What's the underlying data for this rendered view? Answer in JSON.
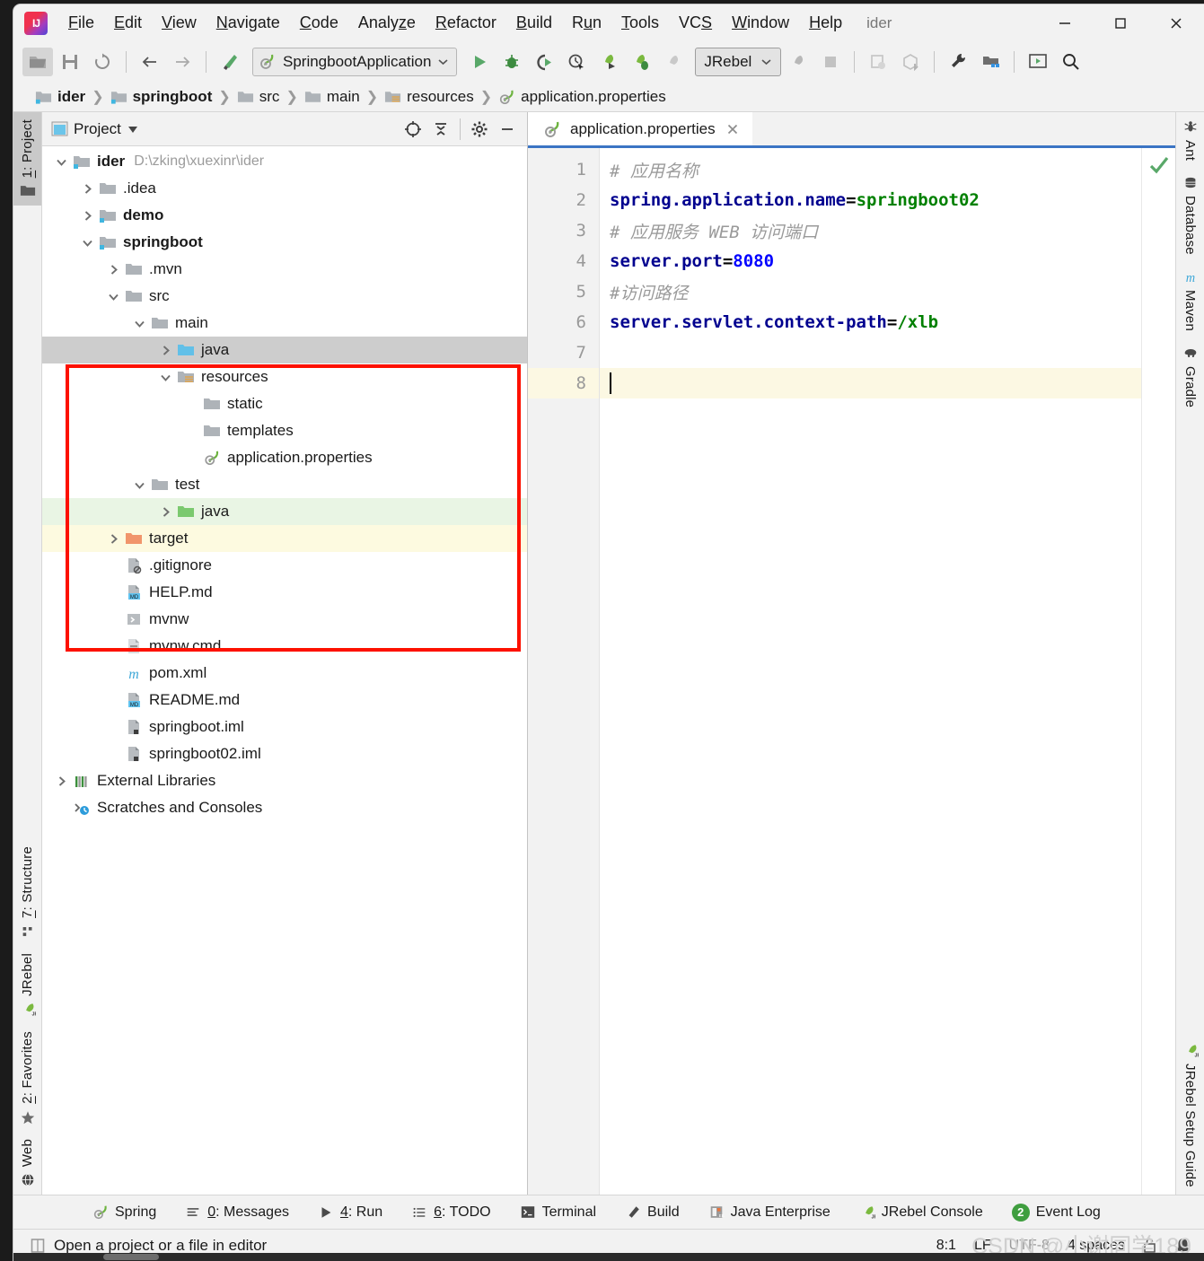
{
  "window": {
    "project_title": "ider",
    "minimize_tooltip": "Minimize",
    "maximize_tooltip": "Maximize",
    "close_tooltip": "Close"
  },
  "menubar": {
    "items": [
      {
        "label": "File",
        "mnemonic": "F"
      },
      {
        "label": "Edit",
        "mnemonic": "E"
      },
      {
        "label": "View",
        "mnemonic": "V"
      },
      {
        "label": "Navigate",
        "mnemonic": "N"
      },
      {
        "label": "Code",
        "mnemonic": "C"
      },
      {
        "label": "Analyze",
        "mnemonic": "z"
      },
      {
        "label": "Refactor",
        "mnemonic": "R"
      },
      {
        "label": "Build",
        "mnemonic": "B"
      },
      {
        "label": "Run",
        "mnemonic": "u"
      },
      {
        "label": "Tools",
        "mnemonic": "T"
      },
      {
        "label": "VCS",
        "mnemonic": "S"
      },
      {
        "label": "Window",
        "mnemonic": "W"
      },
      {
        "label": "Help",
        "mnemonic": "H"
      }
    ]
  },
  "toolbar": {
    "run_config": "SpringbootApplication",
    "jrebel_select": "JRebel",
    "icons": [
      "open-project-icon",
      "save-all-icon",
      "sync-icon",
      "back-icon",
      "forward-icon",
      "build-hammer-icon",
      "run-icon",
      "debug-icon",
      "run-coverage-icon",
      "profile-icon",
      "jrebel-run-icon",
      "jrebel-debug-icon",
      "jrebel-disabled-icon",
      "jrebel-stop-icon",
      "stop-icon",
      "update-project-icon",
      "commit-icon",
      "settings-wrench-icon",
      "project-structure-icon",
      "presentation-icon",
      "search-everywhere-icon"
    ]
  },
  "breadcrumb": {
    "items": [
      {
        "label": "ider",
        "icon": "module-folder-icon",
        "bold": true
      },
      {
        "label": "springboot",
        "icon": "module-folder-icon",
        "bold": true
      },
      {
        "label": "src",
        "icon": "folder-icon",
        "bold": false
      },
      {
        "label": "main",
        "icon": "folder-icon",
        "bold": false
      },
      {
        "label": "resources",
        "icon": "resources-folder-icon",
        "bold": false
      },
      {
        "label": "application.properties",
        "icon": "spring-leaf-icon",
        "bold": false
      }
    ]
  },
  "left_stripe": {
    "items": [
      {
        "label": "1: Project",
        "mnemonic": "1",
        "icon": "project-folder-icon",
        "selected": true
      },
      {
        "label": "7: Structure",
        "mnemonic": "7",
        "icon": "structure-icon",
        "selected": false
      },
      {
        "label": "JRebel",
        "mnemonic": "",
        "icon": "jrebel-rocket-icon",
        "selected": false
      },
      {
        "label": "2: Favorites",
        "mnemonic": "2",
        "icon": "star-icon",
        "selected": false
      },
      {
        "label": "Web",
        "mnemonic": "",
        "icon": "globe-icon",
        "selected": false
      }
    ]
  },
  "right_stripe": {
    "items": [
      {
        "label": "Ant",
        "icon": "ant-bug-icon"
      },
      {
        "label": "Database",
        "icon": "database-icon"
      },
      {
        "label": "Maven",
        "icon": "maven-m-icon"
      },
      {
        "label": "Gradle",
        "icon": "gradle-elephant-icon"
      },
      {
        "label": "JRebel Setup Guide",
        "icon": "jrebel-rocket-icon"
      }
    ]
  },
  "project_panel": {
    "title": "Project",
    "header_icons": [
      "select-opened-file-icon",
      "collapse-all-icon",
      "settings-gear-icon",
      "hide-icon"
    ],
    "tree": [
      {
        "label": "ider",
        "path": "D:\\zking\\xuexinr\\ider",
        "indent": 0,
        "arrow": "down",
        "icon": "module-folder-icon",
        "bold": true,
        "bg": "none"
      },
      {
        "label": ".idea",
        "path": "",
        "indent": 1,
        "arrow": "right",
        "icon": "folder-icon",
        "bold": false,
        "bg": "none"
      },
      {
        "label": "demo",
        "path": "",
        "indent": 1,
        "arrow": "right",
        "icon": "module-folder-icon",
        "bold": true,
        "bg": "none"
      },
      {
        "label": "springboot",
        "path": "",
        "indent": 1,
        "arrow": "down",
        "icon": "module-folder-icon",
        "bold": true,
        "bg": "none"
      },
      {
        "label": ".mvn",
        "path": "",
        "indent": 2,
        "arrow": "right",
        "icon": "folder-icon",
        "bold": false,
        "bg": "none"
      },
      {
        "label": "src",
        "path": "",
        "indent": 2,
        "arrow": "down",
        "icon": "folder-icon",
        "bold": false,
        "bg": "none"
      },
      {
        "label": "main",
        "path": "",
        "indent": 3,
        "arrow": "down",
        "icon": "folder-icon",
        "bold": false,
        "bg": "none"
      },
      {
        "label": "java",
        "path": "",
        "indent": 4,
        "arrow": "right",
        "icon": "source-folder-icon",
        "bold": false,
        "bg": "gray"
      },
      {
        "label": "resources",
        "path": "",
        "indent": 4,
        "arrow": "down",
        "icon": "resources-folder-icon",
        "bold": false,
        "bg": "none"
      },
      {
        "label": "static",
        "path": "",
        "indent": 5,
        "arrow": "none",
        "icon": "folder-icon",
        "bold": false,
        "bg": "none"
      },
      {
        "label": "templates",
        "path": "",
        "indent": 5,
        "arrow": "none",
        "icon": "folder-icon",
        "bold": false,
        "bg": "none"
      },
      {
        "label": "application.properties",
        "path": "",
        "indent": 5,
        "arrow": "none",
        "icon": "spring-leaf-icon",
        "bold": false,
        "bg": "none"
      },
      {
        "label": "test",
        "path": "",
        "indent": 3,
        "arrow": "down",
        "icon": "folder-icon",
        "bold": false,
        "bg": "none"
      },
      {
        "label": "java",
        "path": "",
        "indent": 4,
        "arrow": "right",
        "icon": "test-source-folder-icon",
        "bold": false,
        "bg": "green"
      },
      {
        "label": "target",
        "path": "",
        "indent": 2,
        "arrow": "right",
        "icon": "excluded-folder-icon",
        "bold": false,
        "bg": "yellow"
      },
      {
        "label": ".gitignore",
        "path": "",
        "indent": 2,
        "arrow": "none",
        "icon": "gitignore-file-icon",
        "bold": false,
        "bg": "none"
      },
      {
        "label": "HELP.md",
        "path": "",
        "indent": 2,
        "arrow": "none",
        "icon": "markdown-file-icon",
        "bold": false,
        "bg": "none"
      },
      {
        "label": "mvnw",
        "path": "",
        "indent": 2,
        "arrow": "none",
        "icon": "shell-script-icon",
        "bold": false,
        "bg": "none"
      },
      {
        "label": "mvnw.cmd",
        "path": "",
        "indent": 2,
        "arrow": "none",
        "icon": "text-file-icon",
        "bold": false,
        "bg": "none"
      },
      {
        "label": "pom.xml",
        "path": "",
        "indent": 2,
        "arrow": "none",
        "icon": "maven-m-icon",
        "bold": false,
        "bg": "none"
      },
      {
        "label": "README.md",
        "path": "",
        "indent": 2,
        "arrow": "none",
        "icon": "markdown-file-icon",
        "bold": false,
        "bg": "none"
      },
      {
        "label": "springboot.iml",
        "path": "",
        "indent": 2,
        "arrow": "none",
        "icon": "iml-file-icon",
        "bold": false,
        "bg": "none"
      },
      {
        "label": "springboot02.iml",
        "path": "",
        "indent": 2,
        "arrow": "none",
        "icon": "iml-file-icon",
        "bold": false,
        "bg": "none"
      },
      {
        "label": "External Libraries",
        "path": "",
        "indent": 0,
        "arrow": "right",
        "icon": "libraries-icon",
        "bold": false,
        "bg": "none"
      },
      {
        "label": "Scratches and Consoles",
        "path": "",
        "indent": 0,
        "arrow": "none",
        "icon": "scratches-icon",
        "bold": false,
        "bg": "none"
      }
    ]
  },
  "editor": {
    "tab": {
      "label": "application.properties",
      "icon": "spring-leaf-icon"
    },
    "inspection_status": "ok-checkmark",
    "lines": [
      {
        "num": "1",
        "current": false,
        "tokens": [
          {
            "t": "# 应用名称",
            "c": "cm"
          }
        ]
      },
      {
        "num": "2",
        "current": false,
        "tokens": [
          {
            "t": "spring.application.name",
            "c": "key"
          },
          {
            "t": "=",
            "c": "eq"
          },
          {
            "t": "springboot02",
            "c": "valstr"
          }
        ]
      },
      {
        "num": "3",
        "current": false,
        "tokens": [
          {
            "t": "# 应用服务 WEB 访问端口",
            "c": "cm"
          }
        ]
      },
      {
        "num": "4",
        "current": false,
        "tokens": [
          {
            "t": "server.port",
            "c": "key"
          },
          {
            "t": "=",
            "c": "eq"
          },
          {
            "t": "8080",
            "c": "valnum"
          }
        ]
      },
      {
        "num": "5",
        "current": false,
        "tokens": [
          {
            "t": "#访问路径",
            "c": "cm"
          }
        ]
      },
      {
        "num": "6",
        "current": false,
        "tokens": [
          {
            "t": "server.servlet.context-path",
            "c": "key"
          },
          {
            "t": "=",
            "c": "eq"
          },
          {
            "t": "/xlb",
            "c": "valstr"
          }
        ]
      },
      {
        "num": "7",
        "current": false,
        "tokens": []
      },
      {
        "num": "8",
        "current": true,
        "tokens": []
      }
    ]
  },
  "tool_windows": [
    {
      "label": "Spring",
      "mnemonic": "",
      "icon": "spring-leaf-icon"
    },
    {
      "label": "0: Messages",
      "mnemonic": "0",
      "icon": "messages-icon"
    },
    {
      "label": "4: Run",
      "mnemonic": "4",
      "icon": "run-icon"
    },
    {
      "label": "6: TODO",
      "mnemonic": "6",
      "icon": "todo-icon"
    },
    {
      "label": "Terminal",
      "mnemonic": "",
      "icon": "terminal-icon"
    },
    {
      "label": "Build",
      "mnemonic": "",
      "icon": "build-hammer-icon"
    },
    {
      "label": "Java Enterprise",
      "mnemonic": "",
      "icon": "java-enterprise-icon"
    },
    {
      "label": "JRebel Console",
      "mnemonic": "",
      "icon": "jrebel-rocket-icon"
    },
    {
      "label": "Event Log",
      "mnemonic": "",
      "icon": "event-log-badge",
      "badge": "2"
    }
  ],
  "statusbar": {
    "message": "Open a project or a file in editor",
    "caret_position": "8:1",
    "line_separator": "LF",
    "encoding": "UTF-8",
    "indent": "4 spaces",
    "lock_icon": "unlocked-icon",
    "inspector_icon": "hector-hat-icon",
    "watermark": "CSDN @小谢同学189"
  }
}
